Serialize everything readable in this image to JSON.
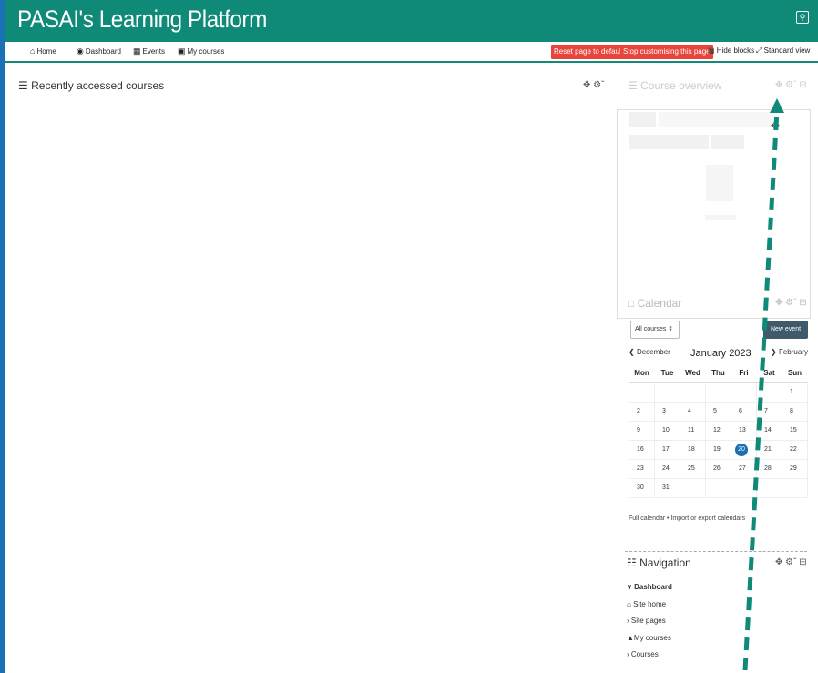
{
  "header": {
    "site_title": "PASAI's Learning Platform"
  },
  "navbar": {
    "home": "Home",
    "dashboard": "Dashboard",
    "events": "Events",
    "my_courses": "My courses",
    "reset_label": "Reset page to default",
    "stop_label": "Stop customising this page",
    "hide_blocks": "Hide blocks",
    "standard_view": "Standard view"
  },
  "main": {
    "recent_title": "Recently accessed courses"
  },
  "overview": {
    "title": "Course overview"
  },
  "calendar": {
    "title": "Calendar",
    "filter": "All courses",
    "new_event": "New event",
    "prev": "December",
    "month": "January 2023",
    "next": "February",
    "days": [
      "Mon",
      "Tue",
      "Wed",
      "Thu",
      "Fri",
      "Sat",
      "Sun"
    ],
    "weeks": [
      [
        "",
        "",
        "",
        "",
        "",
        "",
        "1"
      ],
      [
        "2",
        "3",
        "4",
        "5",
        "6",
        "7",
        "8"
      ],
      [
        "9",
        "10",
        "11",
        "12",
        "13",
        "14",
        "15"
      ],
      [
        "16",
        "17",
        "18",
        "19",
        "20",
        "21",
        "22"
      ],
      [
        "23",
        "24",
        "25",
        "26",
        "27",
        "28",
        "29"
      ],
      [
        "30",
        "31",
        "",
        "",
        "",
        "",
        ""
      ]
    ],
    "today": "20",
    "footer": "Full calendar • Import or export calendars"
  },
  "navigation": {
    "title": "Navigation",
    "items": [
      "Dashboard",
      "Site home",
      "Site pages",
      "My courses",
      "Courses"
    ]
  },
  "colors": {
    "brand": "#0f8a78",
    "danger": "#e8453c",
    "today": "#1a6fb5",
    "arrow": "#0f8a78"
  }
}
